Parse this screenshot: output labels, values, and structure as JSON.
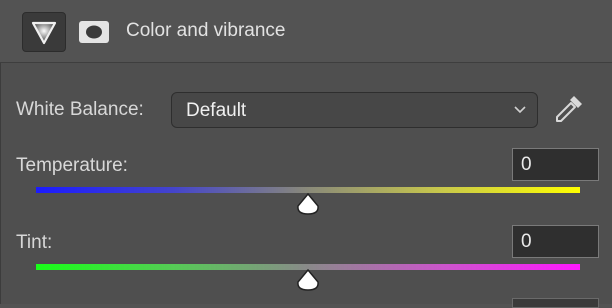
{
  "header": {
    "title": "Color and vibrance",
    "icons": [
      "triangle-tool-icon",
      "mask-icon"
    ]
  },
  "white_balance": {
    "label": "White Balance:",
    "selected": "Default"
  },
  "temperature": {
    "label": "Temperature:",
    "value": "0",
    "slider_position": 0.5
  },
  "tint": {
    "label": "Tint:",
    "value": "0",
    "slider_position": 0.5
  },
  "colors": {
    "panel_bg": "#4f4f4f",
    "temp_left": "#1b1bff",
    "temp_right": "#ffff00",
    "tint_left": "#18ff18",
    "tint_right": "#ff18ff"
  }
}
